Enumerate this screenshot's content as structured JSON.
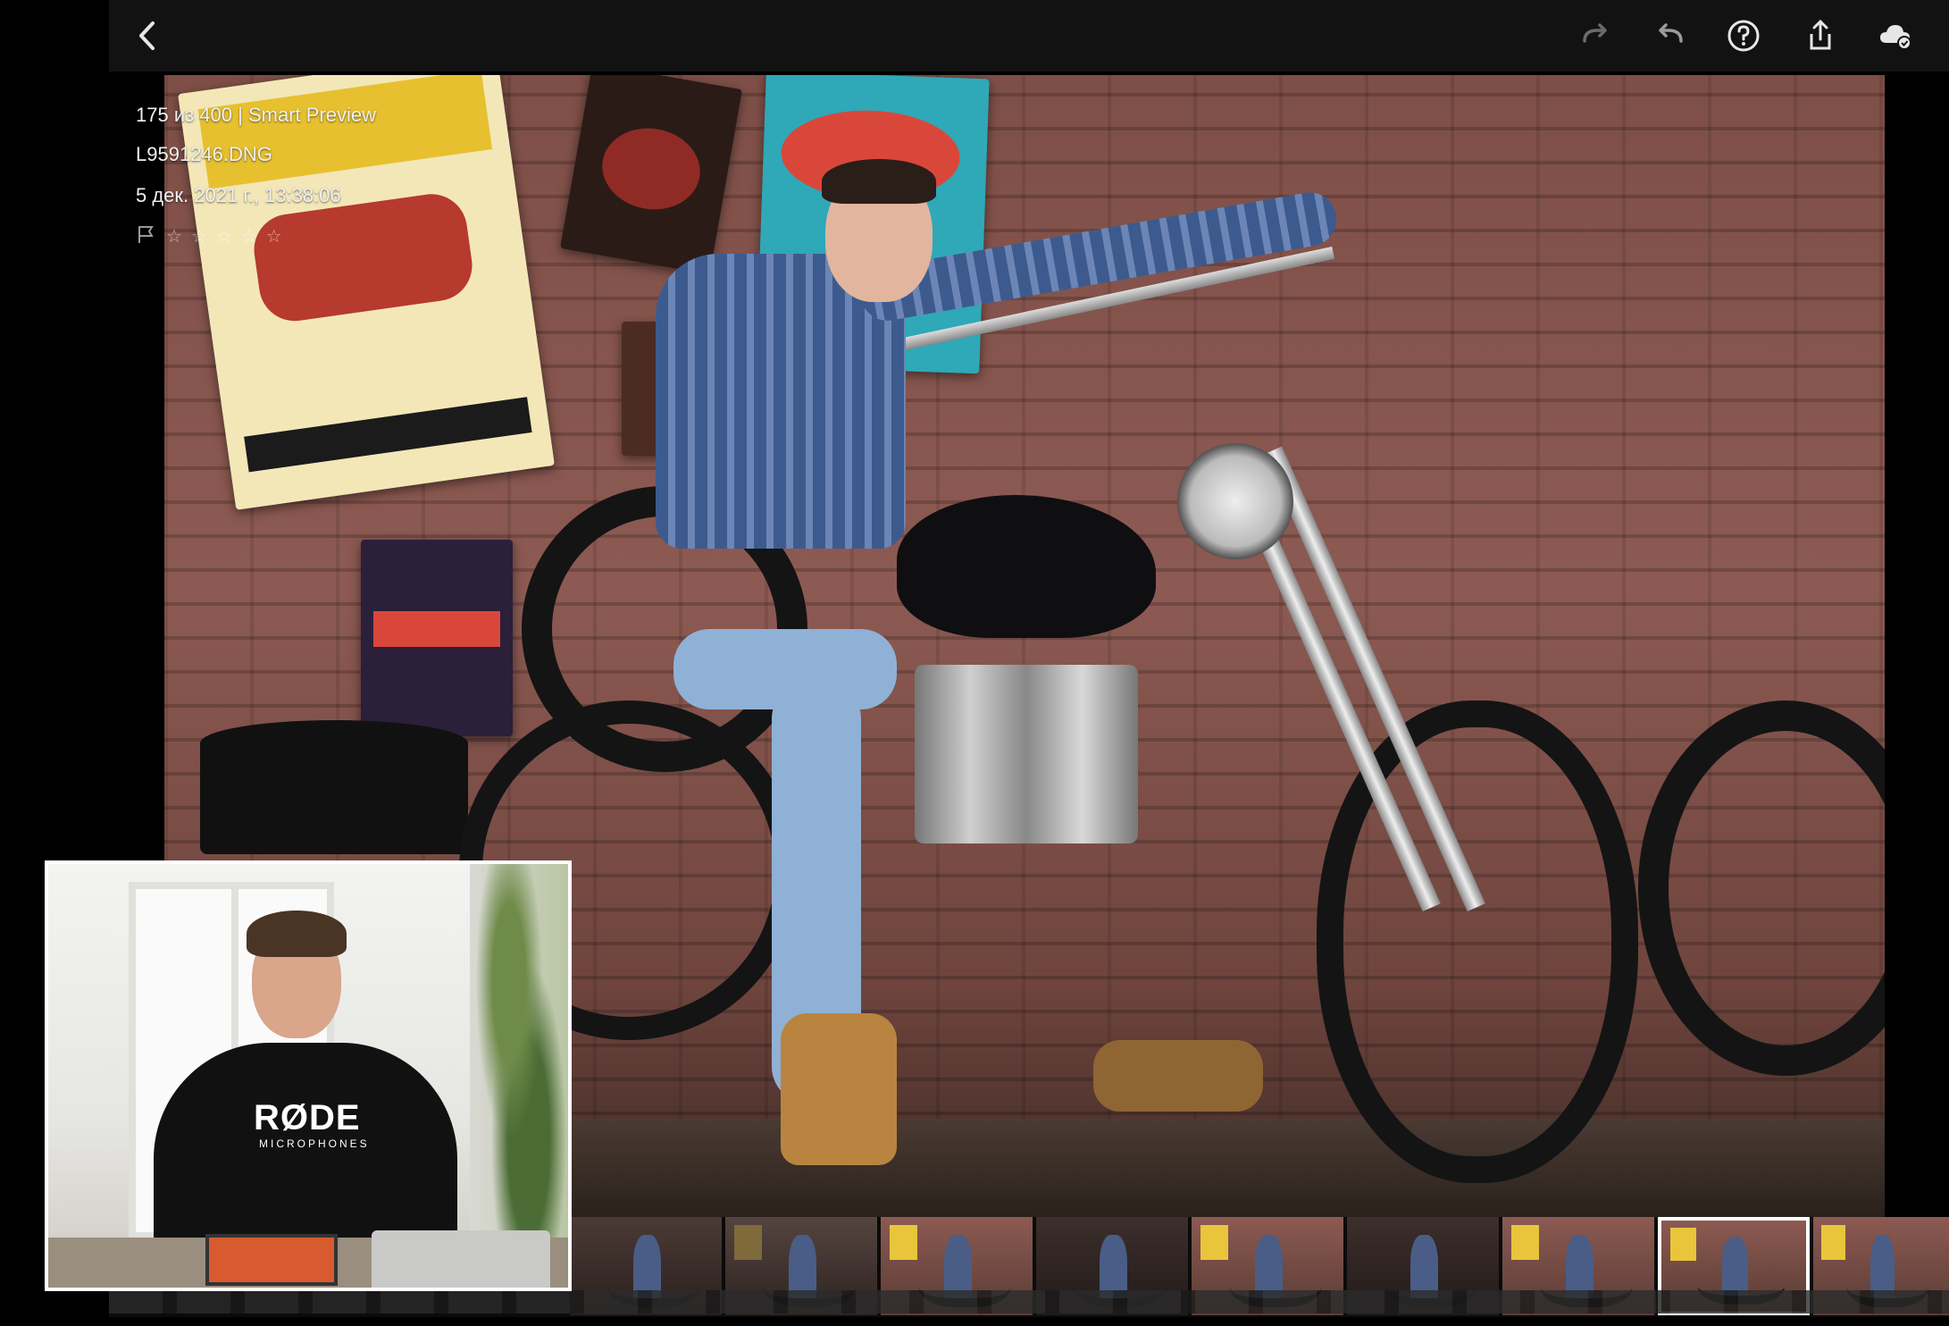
{
  "toolbar": {
    "icons": [
      "chevron-left-icon",
      "redo-icon",
      "undo-icon",
      "help-icon",
      "share-icon",
      "cloud-sync-icon"
    ]
  },
  "photo_info": {
    "counter": "175 из 400 | Smart Preview",
    "filename": "L9591246.DNG",
    "datetime": "5 дек. 2021 г., 13:38:06",
    "stars": 0
  },
  "filmstrip": {
    "thumb_count": 9,
    "selected_index": 6
  },
  "pip": {
    "brand": "RØDE",
    "sub": "MICROPHONES"
  },
  "colors": {
    "topbar": "#121212",
    "accent": "#ffffff"
  }
}
